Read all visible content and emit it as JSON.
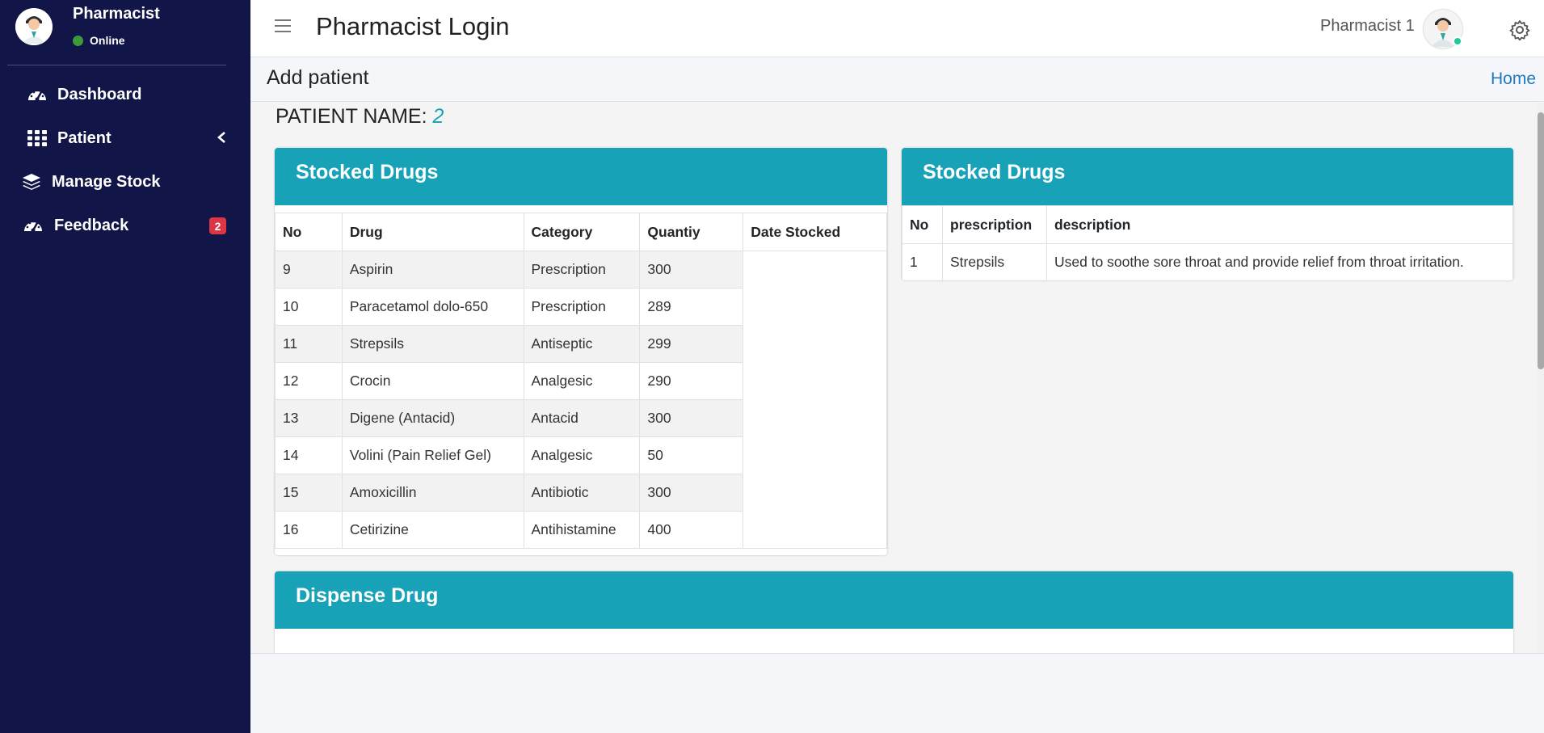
{
  "sidebar": {
    "user_name": "Pharmacist",
    "status": "Online",
    "items": [
      {
        "label": "Dashboard",
        "icon": "dashboard-gauge-icon"
      },
      {
        "label": "Patient",
        "icon": "grid-icon"
      },
      {
        "label": "Manage Stock",
        "icon": "layers-icon"
      },
      {
        "label": "Feedback",
        "icon": "gauge-icon",
        "badge": "2"
      }
    ]
  },
  "header": {
    "title": "Pharmacist Login",
    "user": "Pharmacist 1"
  },
  "subheader": {
    "title": "Add patient",
    "home": "Home"
  },
  "patient": {
    "label": "PATIENT NAME:",
    "value": "2"
  },
  "stock_card": {
    "title": "Stocked Drugs",
    "columns": [
      "No",
      "Drug",
      "Category",
      "Quantiy",
      "Date Stocked"
    ],
    "rows": [
      [
        "9",
        "Aspirin",
        "Prescription",
        "300"
      ],
      [
        "10",
        "Paracetamol dolo-650",
        "Prescription",
        "289"
      ],
      [
        "11",
        "Strepsils",
        "Antiseptic",
        "299"
      ],
      [
        "12",
        "Crocin",
        "Analgesic",
        "290"
      ],
      [
        "13",
        "Digene (Antacid)",
        "Antacid",
        "300"
      ],
      [
        "14",
        "Volini (Pain Relief Gel)",
        "Analgesic",
        "50"
      ],
      [
        "15",
        "Amoxicillin",
        "Antibiotic",
        "300"
      ],
      [
        "16",
        "Cetirizine",
        "Antihistamine",
        "400"
      ]
    ]
  },
  "prescription_card": {
    "title": "Stocked Drugs",
    "columns": [
      "No",
      "prescription",
      "description"
    ],
    "rows": [
      [
        "1",
        "Strepsils",
        "Used to soothe sore throat and provide relief from throat irritation."
      ]
    ]
  },
  "dispense_card": {
    "title": "Dispense Drug"
  },
  "colors": {
    "sidebar": "#111547",
    "accent": "#17a2b8",
    "badge": "#dc3545",
    "online": "#3d9a3a"
  }
}
